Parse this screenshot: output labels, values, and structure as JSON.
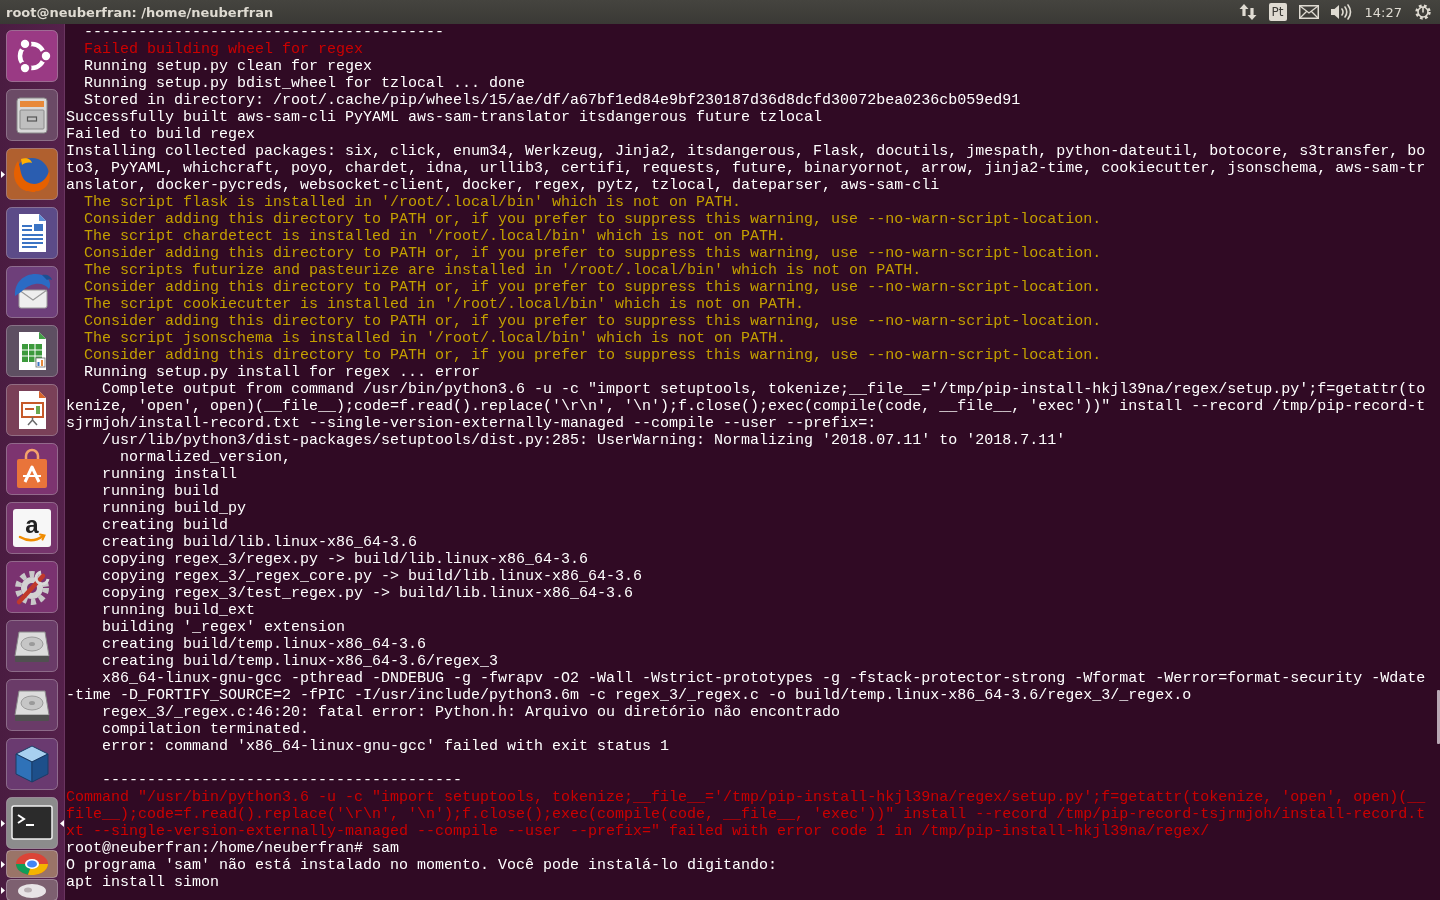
{
  "top_panel": {
    "title": "root@neuberfran: /home/neuberfran",
    "keyboard_layout": "Pt",
    "clock": "14:27"
  },
  "launcher": {
    "items": [
      {
        "kind": "dash",
        "running": false,
        "focused": false
      },
      {
        "kind": "files",
        "running": false,
        "focused": false
      },
      {
        "kind": "browser",
        "running": true,
        "focused": false
      },
      {
        "kind": "writer",
        "running": false,
        "focused": false
      },
      {
        "kind": "mail",
        "running": false,
        "focused": false
      },
      {
        "kind": "calc",
        "running": false,
        "focused": false
      },
      {
        "kind": "impress",
        "running": false,
        "focused": false
      },
      {
        "kind": "store",
        "running": false,
        "focused": false
      },
      {
        "kind": "shop",
        "letter": "a",
        "running": false,
        "focused": false
      },
      {
        "kind": "settings",
        "running": false,
        "focused": false
      },
      {
        "kind": "disk",
        "running": false,
        "focused": false
      },
      {
        "kind": "disk",
        "running": false,
        "focused": false
      },
      {
        "kind": "vm",
        "running": false,
        "focused": false
      },
      {
        "kind": "terminal",
        "running": true,
        "focused": true
      },
      {
        "kind": "chrome",
        "running": true,
        "focused": false
      },
      {
        "kind": "folded",
        "running": true,
        "focused": false
      }
    ]
  },
  "terminal": {
    "lines": [
      {
        "kind": "text",
        "color": "#ffffff",
        "text": "  ----------------------------------------"
      },
      {
        "kind": "text",
        "color": "#cc0000",
        "text": "  Failed building wheel for regex"
      },
      {
        "kind": "text",
        "color": "#ffffff",
        "text": "  Running setup.py clean for regex"
      },
      {
        "kind": "text",
        "color": "#ffffff",
        "text": "  Running setup.py bdist_wheel for tzlocal ... done"
      },
      {
        "kind": "text",
        "color": "#ffffff",
        "text": "  Stored in directory: /root/.cache/pip/wheels/15/ae/df/a67bf1ed84e9bf230187d36d8dcfd30072bea0236cb059ed91"
      },
      {
        "kind": "text",
        "color": "#ffffff",
        "text": "Successfully built aws-sam-cli PyYAML aws-sam-translator itsdangerous future tzlocal"
      },
      {
        "kind": "text",
        "color": "#ffffff",
        "text": "Failed to build regex"
      },
      {
        "kind": "text",
        "color": "#ffffff",
        "text": "Installing collected packages: six, click, enum34, Werkzeug, Jinja2, itsdangerous, Flask, docutils, jmespath, python-dateutil, botocore, s3transfer, bo"
      },
      {
        "kind": "text",
        "color": "#ffffff",
        "text": "to3, PyYAML, whichcraft, poyo, chardet, idna, urllib3, certifi, requests, future, binaryornot, arrow, jinja2-time, cookiecutter, jsonschema, aws-sam-tr"
      },
      {
        "kind": "text",
        "color": "#ffffff",
        "text": "anslator, docker-pycreds, websocket-client, docker, regex, pytz, tzlocal, dateparser, aws-sam-cli"
      },
      {
        "kind": "text",
        "color": "#c4a000",
        "text": "  The script flask is installed in '/root/.local/bin' which is not on PATH."
      },
      {
        "kind": "text",
        "color": "#c4a000",
        "text": "  Consider adding this directory to PATH or, if you prefer to suppress this warning, use --no-warn-script-location."
      },
      {
        "kind": "text",
        "color": "#c4a000",
        "text": "  The script chardetect is installed in '/root/.local/bin' which is not on PATH."
      },
      {
        "kind": "text",
        "color": "#c4a000",
        "text": "  Consider adding this directory to PATH or, if you prefer to suppress this warning, use --no-warn-script-location."
      },
      {
        "kind": "text",
        "color": "#c4a000",
        "text": "  The scripts futurize and pasteurize are installed in '/root/.local/bin' which is not on PATH."
      },
      {
        "kind": "text",
        "color": "#c4a000",
        "text": "  Consider adding this directory to PATH or, if you prefer to suppress this warning, use --no-warn-script-location."
      },
      {
        "kind": "text",
        "color": "#c4a000",
        "text": "  The script cookiecutter is installed in '/root/.local/bin' which is not on PATH."
      },
      {
        "kind": "text",
        "color": "#c4a000",
        "text": "  Consider adding this directory to PATH or, if you prefer to suppress this warning, use --no-warn-script-location."
      },
      {
        "kind": "text",
        "color": "#c4a000",
        "text": "  The script jsonschema is installed in '/root/.local/bin' which is not on PATH."
      },
      {
        "kind": "text",
        "color": "#c4a000",
        "text": "  Consider adding this directory to PATH or, if you prefer to suppress this warning, use --no-warn-script-location."
      },
      {
        "kind": "text",
        "color": "#ffffff",
        "text": "  Running setup.py install for regex ... error"
      },
      {
        "kind": "text",
        "color": "#ffffff",
        "text": "    Complete output from command /usr/bin/python3.6 -u -c \"import setuptools, tokenize;__file__='/tmp/pip-install-hkjl39na/regex/setup.py';f=getattr(to"
      },
      {
        "kind": "text",
        "color": "#ffffff",
        "text": "kenize, 'open', open)(__file__);code=f.read().replace('\\r\\n', '\\n');f.close();exec(compile(code, __file__, 'exec'))\" install --record /tmp/pip-record-t"
      },
      {
        "kind": "text",
        "color": "#ffffff",
        "text": "sjrmjoh/install-record.txt --single-version-externally-managed --compile --user --prefix=:"
      },
      {
        "kind": "text",
        "color": "#ffffff",
        "text": "    /usr/lib/python3/dist-packages/setuptools/dist.py:285: UserWarning: Normalizing '2018.07.11' to '2018.7.11'"
      },
      {
        "kind": "text",
        "color": "#ffffff",
        "text": "      normalized_version,"
      },
      {
        "kind": "text",
        "color": "#ffffff",
        "text": "    running install"
      },
      {
        "kind": "text",
        "color": "#ffffff",
        "text": "    running build"
      },
      {
        "kind": "text",
        "color": "#ffffff",
        "text": "    running build_py"
      },
      {
        "kind": "text",
        "color": "#ffffff",
        "text": "    creating build"
      },
      {
        "kind": "text",
        "color": "#ffffff",
        "text": "    creating build/lib.linux-x86_64-3.6"
      },
      {
        "kind": "text",
        "color": "#ffffff",
        "text": "    copying regex_3/regex.py -> build/lib.linux-x86_64-3.6"
      },
      {
        "kind": "text",
        "color": "#ffffff",
        "text": "    copying regex_3/_regex_core.py -> build/lib.linux-x86_64-3.6"
      },
      {
        "kind": "text",
        "color": "#ffffff",
        "text": "    copying regex_3/test_regex.py -> build/lib.linux-x86_64-3.6"
      },
      {
        "kind": "text",
        "color": "#ffffff",
        "text": "    running build_ext"
      },
      {
        "kind": "text",
        "color": "#ffffff",
        "text": "    building '_regex' extension"
      },
      {
        "kind": "text",
        "color": "#ffffff",
        "text": "    creating build/temp.linux-x86_64-3.6"
      },
      {
        "kind": "text",
        "color": "#ffffff",
        "text": "    creating build/temp.linux-x86_64-3.6/regex_3"
      },
      {
        "kind": "text",
        "color": "#ffffff",
        "text": "    x86_64-linux-gnu-gcc -pthread -DNDEBUG -g -fwrapv -O2 -Wall -Wstrict-prototypes -g -fstack-protector-strong -Wformat -Werror=format-security -Wdate"
      },
      {
        "kind": "text",
        "color": "#ffffff",
        "text": "-time -D_FORTIFY_SOURCE=2 -fPIC -I/usr/include/python3.6m -c regex_3/_regex.c -o build/temp.linux-x86_64-3.6/regex_3/_regex.o"
      },
      {
        "kind": "text",
        "color": "#ffffff",
        "text": "    regex_3/_regex.c:46:20: fatal error: Python.h: Arquivo ou diretório não encontrado"
      },
      {
        "kind": "text",
        "color": "#ffffff",
        "text": "    compilation terminated."
      },
      {
        "kind": "text",
        "color": "#ffffff",
        "text": "    error: command 'x86_64-linux-gnu-gcc' failed with exit status 1"
      },
      {
        "kind": "blank"
      },
      {
        "kind": "text",
        "color": "#ffffff",
        "text": "    ----------------------------------------"
      },
      {
        "kind": "text",
        "color": "#cc0000",
        "text": "Command \"/usr/bin/python3.6 -u -c \"import setuptools, tokenize;__file__='/tmp/pip-install-hkjl39na/regex/setup.py';f=getattr(tokenize, 'open', open)(__"
      },
      {
        "kind": "text",
        "color": "#cc0000",
        "text": "file__);code=f.read().replace('\\r\\n', '\\n');f.close();exec(compile(code, __file__, 'exec'))\" install --record /tmp/pip-record-tsjrmjoh/install-record.t"
      },
      {
        "kind": "text",
        "color": "#cc0000",
        "text": "xt --single-version-externally-managed --compile --user --prefix=\" failed with error code 1 in /tmp/pip-install-hkjl39na/regex/"
      },
      {
        "kind": "text",
        "color": "#ffffff",
        "text": "root@neuberfran:/home/neuberfran# sam"
      },
      {
        "kind": "text",
        "color": "#ffffff",
        "text": "O programa 'sam' não está instalado no momento. Você pode instalá-lo digitando:"
      },
      {
        "kind": "text",
        "color": "#ffffff",
        "text": "apt install simon"
      }
    ]
  }
}
